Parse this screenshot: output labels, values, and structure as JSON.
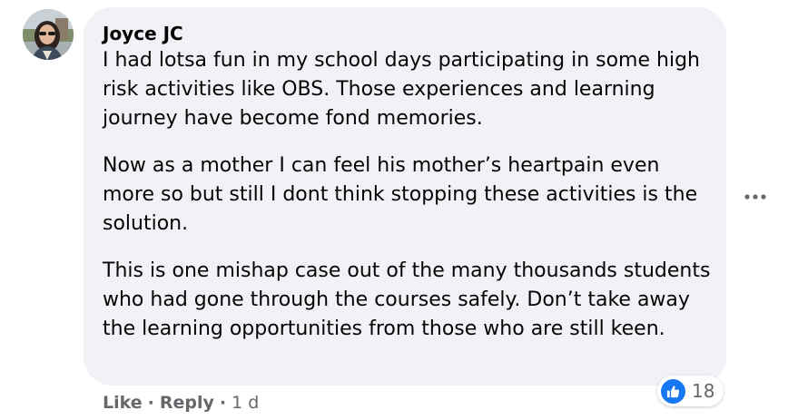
{
  "comment": {
    "author": "Joyce JC",
    "paragraphs": [
      "I had lotsa fun in my school days participating in some high risk activities like OBS. Those experiences and learning journey have become fond memories.",
      "Now as a mother I can feel his mother’s heartpain even more so but still I dont think stopping these activities is the solution.",
      "This is one mishap case out of the many thousands students who had gone through the courses safely. Don’t take away the learning opportunities from those who are still keen."
    ],
    "reaction": {
      "icon": "like-icon",
      "count": "18",
      "color": "#1877f2"
    }
  },
  "actions": {
    "like_label": "Like",
    "separator": "·",
    "reply_label": "Reply",
    "timestamp": "1 d"
  },
  "menu": {
    "icon": "more-options-icon"
  },
  "colors": {
    "bubble_bg": "#f0f2f5",
    "secondary_text": "#65676b",
    "primary_text": "#050505"
  }
}
